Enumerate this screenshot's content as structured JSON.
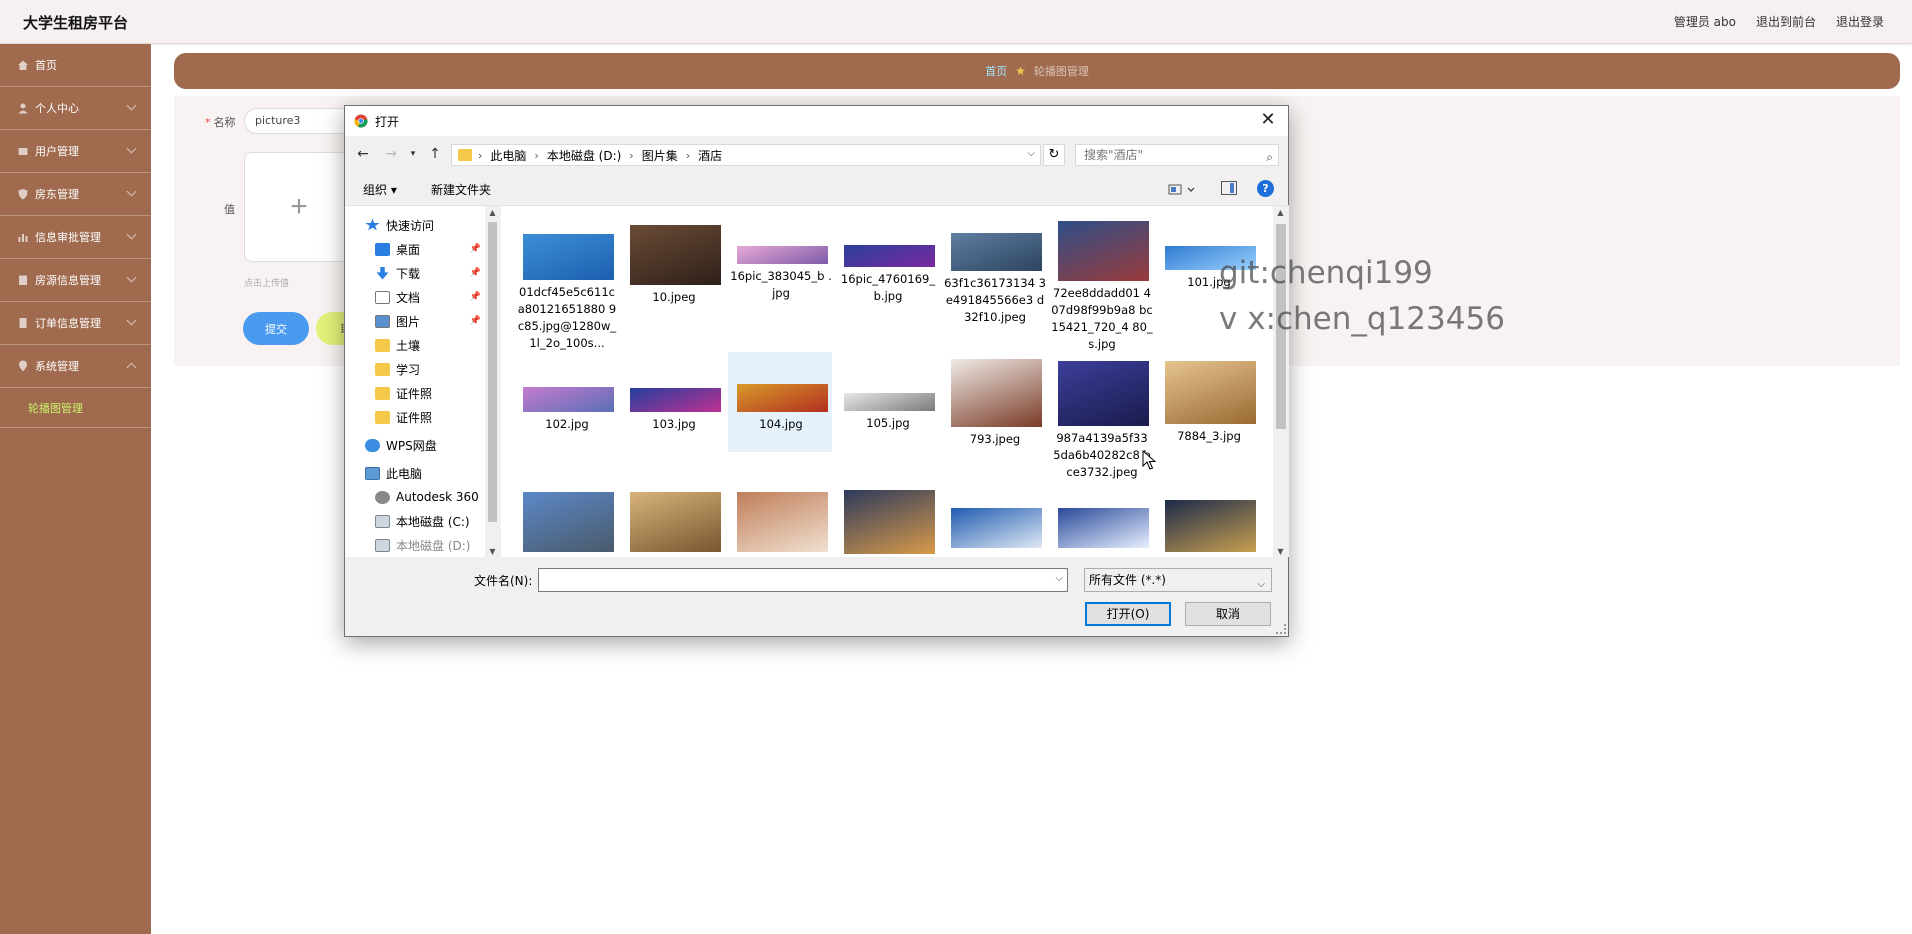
{
  "app": {
    "brand": "大学生租房平台",
    "header_links": [
      "管理员 abo",
      "退出到前台",
      "退出登录"
    ]
  },
  "sidebar": {
    "items": [
      {
        "label": "首页",
        "icon": "home-icon"
      },
      {
        "label": "个人中心",
        "icon": "user-icon"
      },
      {
        "label": "用户管理",
        "icon": "users-icon"
      },
      {
        "label": "房东管理",
        "icon": "shield-icon"
      },
      {
        "label": "信息审批管理",
        "icon": "bar-chart-icon"
      },
      {
        "label": "房源信息管理",
        "icon": "building-icon"
      },
      {
        "label": "订单信息管理",
        "icon": "document-icon"
      },
      {
        "label": "系统管理",
        "icon": "location-icon"
      }
    ],
    "sub_item": "轮播图管理"
  },
  "breadcrumb": {
    "home": "首页",
    "current": "轮播图管理"
  },
  "form": {
    "name_label": "名称",
    "name_value": "picture3",
    "value_label": "值",
    "upload_hint": "点击上传值",
    "submit_label": "提交",
    "cancel_label": "取"
  },
  "dialog": {
    "title": "打开",
    "close": "✕",
    "path": [
      "此电脑",
      "本地磁盘 (D:)",
      "图片集",
      "酒店"
    ],
    "search_placeholder": "搜索\"酒店\"",
    "organize": "组织 ▾",
    "new_folder": "新建文件夹",
    "help": "?",
    "nav_pane": [
      {
        "label": "快速访问",
        "icon": "star-icon",
        "pinned": false
      },
      {
        "label": "桌面",
        "icon": "desktop-icon",
        "pinned": true
      },
      {
        "label": "下载",
        "icon": "download-icon",
        "pinned": true
      },
      {
        "label": "文档",
        "icon": "documents-icon",
        "pinned": true
      },
      {
        "label": "图片",
        "icon": "pictures-icon",
        "pinned": true
      },
      {
        "label": "土壤",
        "icon": "folder-icon",
        "pinned": false
      },
      {
        "label": "学习",
        "icon": "folder-icon",
        "pinned": false
      },
      {
        "label": "证件照",
        "icon": "folder-icon",
        "pinned": false
      },
      {
        "label": "证件照",
        "icon": "folder-icon",
        "pinned": false
      },
      {
        "label": "WPS网盘",
        "icon": "cloud-icon",
        "pinned": false
      },
      {
        "label": "此电脑",
        "icon": "computer-icon",
        "pinned": false
      },
      {
        "label": "Autodesk 360",
        "icon": "autodesk-icon",
        "pinned": false
      },
      {
        "label": "本地磁盘 (C:)",
        "icon": "drive-icon",
        "pinned": false
      },
      {
        "label": "本地磁盘 (D:)",
        "icon": "drive-icon",
        "pinned": false
      }
    ],
    "files": [
      {
        "name": "01dcf45e5c611ca80121651880 9c85.jpg@1280w_1l_2o_100s...",
        "palette": [
          "#3e8ed8",
          "#1b5fae"
        ],
        "selected": false
      },
      {
        "name": "10.jpeg",
        "palette": [
          "#6b4b36",
          "#2e2019"
        ],
        "selected": false
      },
      {
        "name": "16pic_383045_b .jpg",
        "palette": [
          "#e8a9d6",
          "#7c5aa8"
        ],
        "selected": false
      },
      {
        "name": "16pic_4760169_ b.jpg",
        "palette": [
          "#2b3f9a",
          "#7a2aa0"
        ],
        "selected": false
      },
      {
        "name": "63f1c36173134 3e491845566e3 d32f10.jpeg",
        "palette": [
          "#5f7ea2",
          "#2d4460"
        ],
        "selected": false
      },
      {
        "name": "72ee8ddadd01 407d98f99b9a8 bc15421_720_4 80_s.jpg",
        "palette": [
          "#2e4e88",
          "#9a3b3b"
        ],
        "selected": false
      },
      {
        "name": "101.jpg",
        "palette": [
          "#2f7bd0",
          "#9ad0ff"
        ],
        "selected": false
      },
      {
        "name": "102.jpg",
        "palette": [
          "#c47bd0",
          "#5b6fb5"
        ],
        "selected": false
      },
      {
        "name": "103.jpg",
        "palette": [
          "#2440a0",
          "#c03090"
        ],
        "selected": false
      },
      {
        "name": "104.jpg",
        "palette": [
          "#d89a2a",
          "#b22f20"
        ],
        "selected": true
      },
      {
        "name": "105.jpg",
        "palette": [
          "#e8e8e8",
          "#7a7a7a"
        ],
        "selected": false
      },
      {
        "name": "793.jpeg",
        "palette": [
          "#f0ebe6",
          "#7a3b28"
        ],
        "selected": false
      },
      {
        "name": "987a4139a5f33 5da6b40282c8 bce3732.jpeg",
        "palette": [
          "#3c3f9a",
          "#1a1b4d"
        ],
        "selected": false
      },
      {
        "name": "7884_3.jpg",
        "palette": [
          "#e6c48e",
          "#9a6a34"
        ],
        "selected": false
      },
      {
        "name": "",
        "palette": [
          "#5c88c8",
          "#4a5a6a"
        ],
        "selected": false
      },
      {
        "name": "",
        "palette": [
          "#d8b47a",
          "#7a5530"
        ],
        "selected": false
      },
      {
        "name": "",
        "palette": [
          "#c07e5a",
          "#f0e0d0"
        ],
        "selected": false
      },
      {
        "name": "",
        "palette": [
          "#2d3a5c",
          "#d89a4a"
        ],
        "selected": false
      },
      {
        "name": "",
        "palette": [
          "#1f5cb0",
          "#e0e8f4"
        ],
        "selected": false
      },
      {
        "name": "",
        "palette": [
          "#2a4a9a",
          "#e8f0ff"
        ],
        "selected": false
      },
      {
        "name": "",
        "palette": [
          "#1c2a4a",
          "#c8a050"
        ],
        "selected": false
      }
    ],
    "filename_label": "文件名(N):",
    "filename_value": "",
    "filetype": "所有文件 (*.*)",
    "open_label": "打开(O)",
    "cancel_label": "取消"
  },
  "watermark": [
    "git:chenqi199",
    "v x:chen_q123456"
  ],
  "colors": {
    "accent": "#a06a4f",
    "header_bg": "#f7f0f0",
    "submit": "#4a9bf0",
    "active_sub": "#c8f06a",
    "dialog_focus": "#0078d7"
  }
}
